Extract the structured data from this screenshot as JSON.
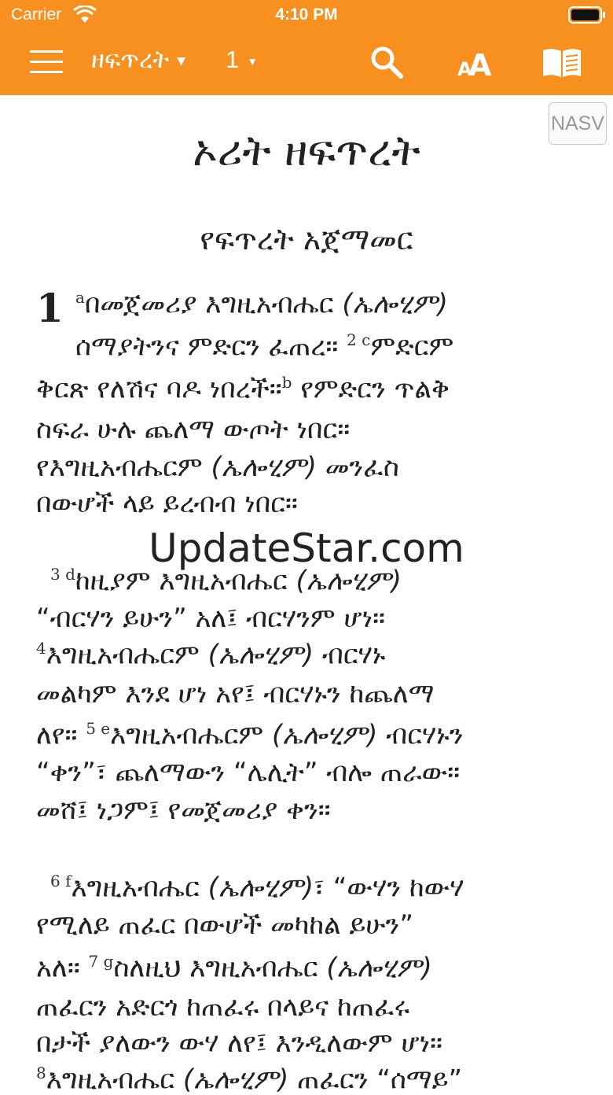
{
  "status": {
    "carrier": "Carrier",
    "time": "4:10 PM"
  },
  "nav": {
    "book": "ዘፍጥረት",
    "chapter": "1"
  },
  "version_badge": "NASV",
  "book_title": "ኦሪት ዘፍጥረት",
  "section_heading": "የፍጥረት አጀማመር",
  "chapter_number": "1",
  "watermark": "UpdateStar.com",
  "lines": [
    [
      "",
      "a",
      "በመጀመሪያ እግዚአብሔር ",
      "(ኤሎሂም)"
    ],
    [
      "ሰማያትንና ምድርን ፈጠረ። ",
      "2 c",
      "ምድርም"
    ],
    [
      "ቅርጽ የለሽና ባዶ ነበረች።",
      "b",
      " የምድርን ጥልቅ"
    ],
    [
      "ስፍራ ሁሉ ጨለማ ውጦት ነበር።"
    ],
    [
      "የእግዚአብሔርም ",
      "(ኤሎሂም)",
      " መንፈስ"
    ],
    [
      "በውሆች ላይ ይረብብ ነበር።"
    ],
    [
      "",
      "3 d",
      "ከዚያም እግዚአብሔር ",
      "(ኤሎሂም)"
    ],
    [
      "“ብርሃን ይሁን” አለ፤ ብርሃንም ሆነ።"
    ],
    [
      "",
      "4",
      "እግዚአብሔርም ",
      "(ኤሎሂም)",
      " ብርሃኑ"
    ],
    [
      "መልካም እንደ ሆነ አየ፤ ብርሃኑን ከጨለማ"
    ],
    [
      "ለየ። ",
      "5 e",
      "እግዚአብሔርም ",
      "(ኤሎሂም)",
      " ብርሃኑን"
    ],
    [
      "“ቀን”፣ ጨለማውን “ሌሊት” ብሎ ጠራው።"
    ],
    [
      "መሸ፤ ነጋም፤ የመጀመሪያ ቀን።"
    ],
    [
      "",
      "6 f",
      "እግዚአብሔር ",
      "(ኤሎሂም)",
      "፣ “ውሃን ከውሃ"
    ],
    [
      "የሚለይ ጠፈር በውሆች መካከል ይሁን”"
    ],
    [
      "አለ። ",
      "7 g",
      "ስለዚህ እግዚአብሔር ",
      "(ኤሎሂም)"
    ],
    [
      "ጠፈርን አድርጎ ከጠፈሩ በላይና ከጠፈሩ"
    ],
    [
      "በታች ያለውን ውሃ ለየ፤ እንዲለውም ሆነ።"
    ],
    [
      "",
      "8",
      "እግዚአብሔር ",
      "(ኤሎሂም)",
      " ጠፈርን “ሰማይ”"
    ]
  ]
}
